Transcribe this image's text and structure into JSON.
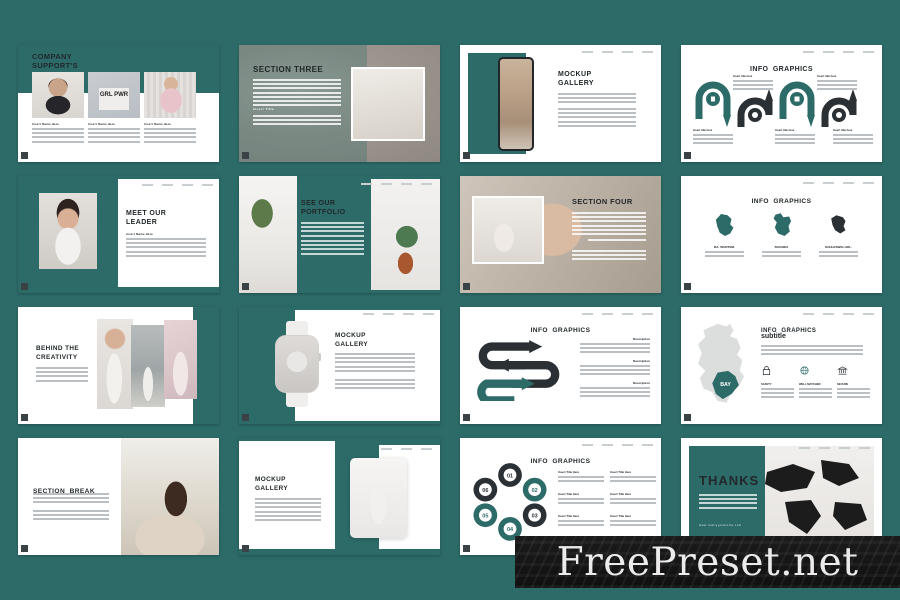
{
  "background_color": "#2c6b68",
  "accent_color": "#2c6b68",
  "watermark": {
    "text": "FreePreset.net"
  },
  "slides": [
    {
      "id": "company-supports",
      "title_line1": "COMPANY",
      "title_line2": "SUPPORT'S",
      "cards": [
        {
          "caption": "Insert Name Here"
        },
        {
          "caption": "Insert Name Here"
        },
        {
          "caption": "Insert Name Here"
        }
      ],
      "photo_label": "GRL PWR"
    },
    {
      "id": "section-three",
      "title": "SECTION THREE",
      "kicker": "Insert Title"
    },
    {
      "id": "mockup-gallery-phone",
      "title_line1": "MOCKUP",
      "title_line2": "GALLERY"
    },
    {
      "id": "info-graphics-snake",
      "title_dark": "INFO",
      "title_accent": "GRAPHICS",
      "items": [
        {
          "label": "Insert title here"
        },
        {
          "label": "Insert title here"
        },
        {
          "label": "Insert title here"
        },
        {
          "label": "Insert title here"
        },
        {
          "label": "Insert title here"
        },
        {
          "label": "Insert title here"
        }
      ]
    },
    {
      "id": "meet-our-leader",
      "title_line1": "MEET OUR",
      "title_line2": "LEADER",
      "subtitle": "Insert Name Here"
    },
    {
      "id": "see-our-portfolio",
      "title_line1": "SEE OUR",
      "title_line2": "PORTFOLIO"
    },
    {
      "id": "section-four",
      "title": "SECTION FOUR"
    },
    {
      "id": "info-graphics-regions",
      "title_dark": "INFO",
      "title_accent": "GRAPHICS",
      "regions": [
        {
          "name": "BA. WURTEM."
        },
        {
          "name": "BAVARIA"
        },
        {
          "name": "SCHLESWIG HOL."
        }
      ]
    },
    {
      "id": "behind-the-creativity",
      "title_line1": "BEHIND THE",
      "title_line2": "CREATIVITY"
    },
    {
      "id": "mockup-gallery-watch",
      "title_line1": "MOCKUP",
      "title_line2": "GALLERY"
    },
    {
      "id": "info-graphics-zigzag",
      "title_dark": "INFO",
      "title_accent": "GRAPHICS",
      "descriptions": [
        {
          "heading": "Description"
        },
        {
          "heading": "Description"
        },
        {
          "heading": "Description"
        }
      ]
    },
    {
      "id": "info-graphics-germany",
      "title_dark": "INFO",
      "title_accent": "GRAPHICS",
      "subtitle": "subtitle",
      "map_label": "BAY",
      "features": [
        {
          "icon": "lock-icon",
          "label": "SAFETY"
        },
        {
          "icon": "globe-icon",
          "label": "WELL MATCHED"
        },
        {
          "icon": "bank-icon",
          "label": "SECURE"
        }
      ]
    },
    {
      "id": "section-break",
      "title_dark": "SECTION",
      "title_accent": "BREAK"
    },
    {
      "id": "mockup-gallery-tablet",
      "title_line1": "MOCKUP",
      "title_line2": "GALLERY"
    },
    {
      "id": "info-graphics-rings",
      "title_dark": "INFO",
      "title_accent": "GRAPHICS",
      "rings": [
        "01",
        "02",
        "03",
        "04",
        "05",
        "06"
      ],
      "items": [
        {
          "heading": "Insert Title Here"
        },
        {
          "heading": "Insert Title Here"
        },
        {
          "heading": "Insert Title Here"
        },
        {
          "heading": "Insert Title Here"
        },
        {
          "heading": "Insert Title Here"
        },
        {
          "heading": "Insert Title Here"
        }
      ]
    },
    {
      "id": "thanks",
      "title": "THANKS",
      "url": "www.reallygreatsite.com"
    }
  ]
}
